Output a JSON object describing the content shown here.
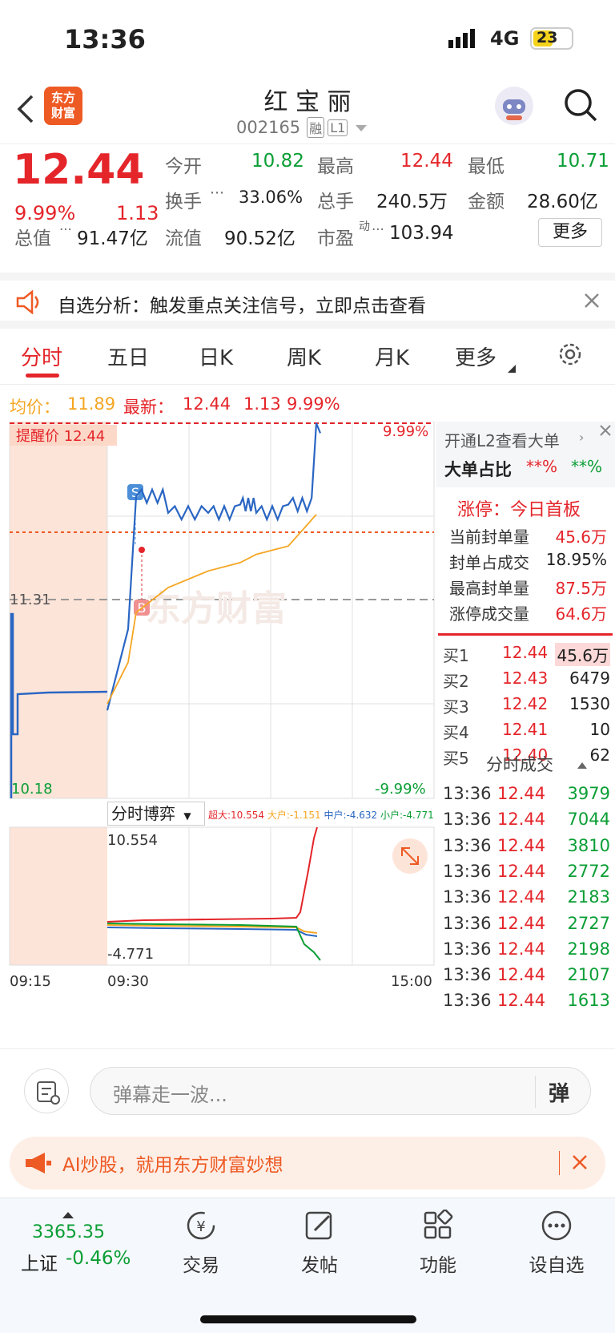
{
  "status": {
    "time": "13:36",
    "network": "4G",
    "battery": "23"
  },
  "nav": {
    "brand_line1": "东方",
    "brand_line2": "财富",
    "stock_name": "红 宝 丽",
    "stock_code": "002165",
    "tag_rong": "融",
    "tag_level": "L1"
  },
  "quote": {
    "price": "12.44",
    "change_pct": "9.99%",
    "change": "1.13",
    "open_label": "今开",
    "open": "10.82",
    "high_label": "最高",
    "high": "12.44",
    "low_label": "最低",
    "low": "10.71",
    "turnover_label": "换手",
    "turnover": "33.06%",
    "volume_label": "总手",
    "volume": "240.5万",
    "amount_label": "金额",
    "amount": "28.60亿",
    "mcap_label": "总值",
    "mcap": "91.47亿",
    "float_label": "流值",
    "float": "90.52亿",
    "pe_label": "市盈",
    "pe_sup": "动",
    "pe": "103.94",
    "more": "更多"
  },
  "alert": {
    "text": "自选分析：触发重点关注信号，立即点击查看"
  },
  "tabs": [
    {
      "label": "分时"
    },
    {
      "label": "五日"
    },
    {
      "label": "日K"
    },
    {
      "label": "周K"
    },
    {
      "label": "月K"
    },
    {
      "label": "更多"
    }
  ],
  "legend": {
    "avg_label": "均价：",
    "avg": "11.89",
    "latest_label": "最新：",
    "latest": "12.44",
    "chg": "1.13",
    "pct": "9.99%"
  },
  "chart": {
    "alert_price": "提醒价 12.44",
    "top_price": "12.44",
    "top_pct": "9.99%",
    "mid_price": "11.31",
    "bottom_price": "10.18",
    "bottom_pct": "-9.99%",
    "marker_s": "S",
    "marker_b": "B",
    "watermark": "东方财富",
    "game_label": "分时博弈",
    "flow_super": "超大:10.554",
    "flow_big": "大户:-1.151",
    "flow_mid": "中户:-4.632",
    "flow_small": "小户:-4.771",
    "flow_max": "10.554",
    "flow_min": "-4.771",
    "time_start": "09:15",
    "time_open": "09:30",
    "time_end": "15:00"
  },
  "chart_data": {
    "type": "line",
    "x": [
      "09:30",
      "09:45",
      "10:00",
      "10:30",
      "11:00",
      "11:30",
      "13:00",
      "13:30",
      "13:36"
    ],
    "series": [
      {
        "name": "最新",
        "values": [
          10.71,
          11.2,
          12.0,
          11.9,
          11.9,
          11.95,
          11.9,
          11.95,
          12.44
        ]
      },
      {
        "name": "均价",
        "values": [
          10.75,
          11.0,
          11.3,
          11.45,
          11.55,
          11.6,
          11.65,
          11.7,
          11.89
        ]
      }
    ],
    "ylim": [
      10.18,
      12.44
    ]
  },
  "side": {
    "l2_label": "开通L2查看大单",
    "big_label": "大单占比",
    "big_a": "**%",
    "big_b": "**%",
    "limit_title": "涨停：今日首板",
    "rows": [
      {
        "k": "当前封单量",
        "v": "45.6万"
      },
      {
        "k": "封单占成交",
        "v": "18.95%"
      },
      {
        "k": "最高封单量",
        "v": "87.5万"
      },
      {
        "k": "涨停成交量",
        "v": "64.6万"
      }
    ],
    "bids": [
      {
        "k": "买1",
        "p": "12.44",
        "v": "45.6万"
      },
      {
        "k": "买2",
        "p": "12.43",
        "v": "6479"
      },
      {
        "k": "买3",
        "p": "12.42",
        "v": "1530"
      },
      {
        "k": "买4",
        "p": "12.41",
        "v": "10"
      },
      {
        "k": "买5",
        "p": "12.40",
        "v": "62"
      }
    ],
    "trades_title": "分时成交",
    "trades": [
      {
        "t": "13:36",
        "p": "12.44",
        "v": "3979"
      },
      {
        "t": "13:36",
        "p": "12.44",
        "v": "7044"
      },
      {
        "t": "13:36",
        "p": "12.44",
        "v": "3810"
      },
      {
        "t": "13:36",
        "p": "12.44",
        "v": "2772"
      },
      {
        "t": "13:36",
        "p": "12.44",
        "v": "2183"
      },
      {
        "t": "13:36",
        "p": "12.44",
        "v": "2727"
      },
      {
        "t": "13:36",
        "p": "12.44",
        "v": "2198"
      },
      {
        "t": "13:36",
        "p": "12.44",
        "v": "2107"
      },
      {
        "t": "13:36",
        "p": "12.44",
        "v": "1613"
      }
    ]
  },
  "input": {
    "placeholder": "弹幕走一波...",
    "danmu": "弹"
  },
  "ai": {
    "text": "AI炒股，就用东方财富妙想"
  },
  "bottom": {
    "index_value": "3365.35",
    "index_name": "上证",
    "index_pct": "-0.46%",
    "items": [
      {
        "label": "交易"
      },
      {
        "label": "发帖"
      },
      {
        "label": "功能"
      },
      {
        "label": "设自选"
      }
    ]
  }
}
